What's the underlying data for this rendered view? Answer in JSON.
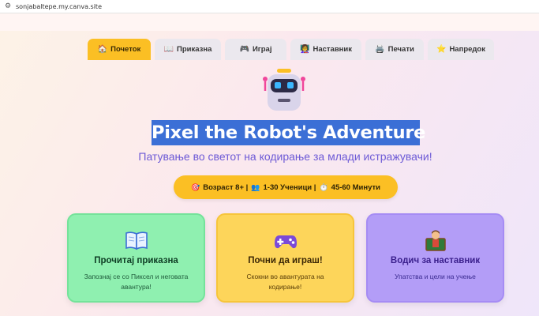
{
  "browser": {
    "url": "sonjabaltepe.my.canva.site"
  },
  "tabs": [
    {
      "icon": "🏠",
      "label": "Почеток",
      "active": true
    },
    {
      "icon": "📖",
      "label": "Приказна",
      "active": false
    },
    {
      "icon": "🎮",
      "label": "Играј",
      "active": false
    },
    {
      "icon": "👩‍🏫",
      "label": "Наставник",
      "active": false
    },
    {
      "icon": "🖨️",
      "label": "Печати",
      "active": false
    },
    {
      "icon": "⭐",
      "label": "Напредок",
      "active": false
    }
  ],
  "hero": {
    "title": "Pixel the Robot's Adventure",
    "subtitle": "Патување во светот на кодирање за млади истражувачи!"
  },
  "info_pill": {
    "age_icon": "🎯",
    "age": "Возраст 8+ |",
    "students_icon": "👥",
    "students": "1-30 Ученици |",
    "time_icon": "⏱️",
    "time": "45-60 Минути"
  },
  "cards": [
    {
      "title": "Прочитај приказна",
      "description": "Запознај се со Пиксел и неговата авантура!",
      "icon": "open-book-icon"
    },
    {
      "title": "Почни да играш!",
      "description": "Скокни во авантурата на кодирање!",
      "icon": "game-controller-icon"
    },
    {
      "title": "Водич за наставник",
      "description": "Упатства и цели на учење",
      "icon": "teacher-icon"
    }
  ]
}
